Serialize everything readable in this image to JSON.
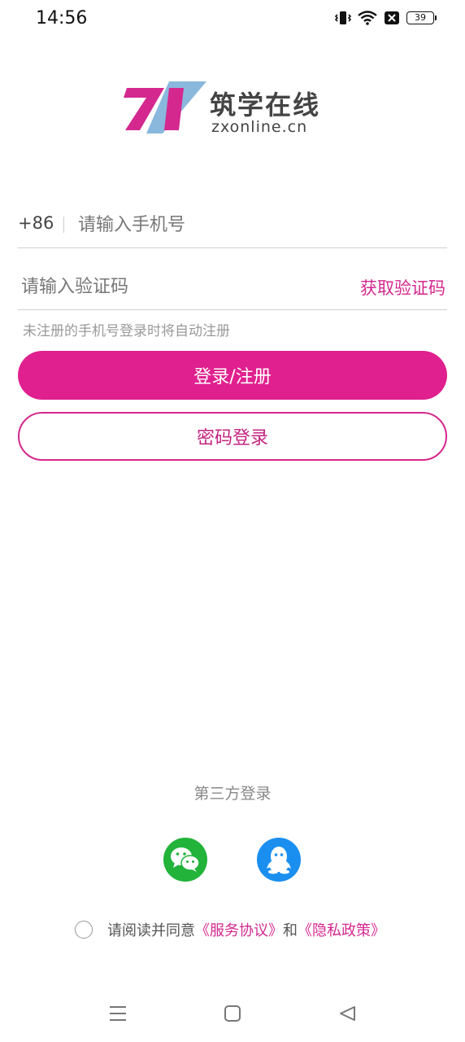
{
  "status_bar": {
    "time": "14:56",
    "battery": "39",
    "icons": [
      "vibrate-icon",
      "wifi-icon",
      "notification-close-icon",
      "battery-icon"
    ]
  },
  "brand": {
    "title": "筑学在线",
    "domain": "zxonline.cn",
    "colors": {
      "magenta": "#d4288f",
      "blue": "#8ab8dd"
    }
  },
  "login_form": {
    "country_code": "+86",
    "phone_placeholder": "请输入手机号",
    "code_placeholder": "请输入验证码",
    "get_code_label": "获取验证码",
    "hint": "未注册的手机号登录时将自动注册",
    "login_button": "登录/注册",
    "password_login_button": "密码登录"
  },
  "third_party": {
    "title": "第三方登录",
    "providers": [
      "wechat-icon",
      "qq-icon"
    ],
    "colors": {
      "wechat": "#22b33a",
      "qq": "#1a8ff0"
    }
  },
  "agreement": {
    "prefix": "请阅读并同意",
    "service": "《服务协议》",
    "and": "和",
    "privacy": "《隐私政策》"
  },
  "nav_bar": {
    "icons": [
      "menu-icon",
      "home-icon",
      "back-icon"
    ]
  }
}
